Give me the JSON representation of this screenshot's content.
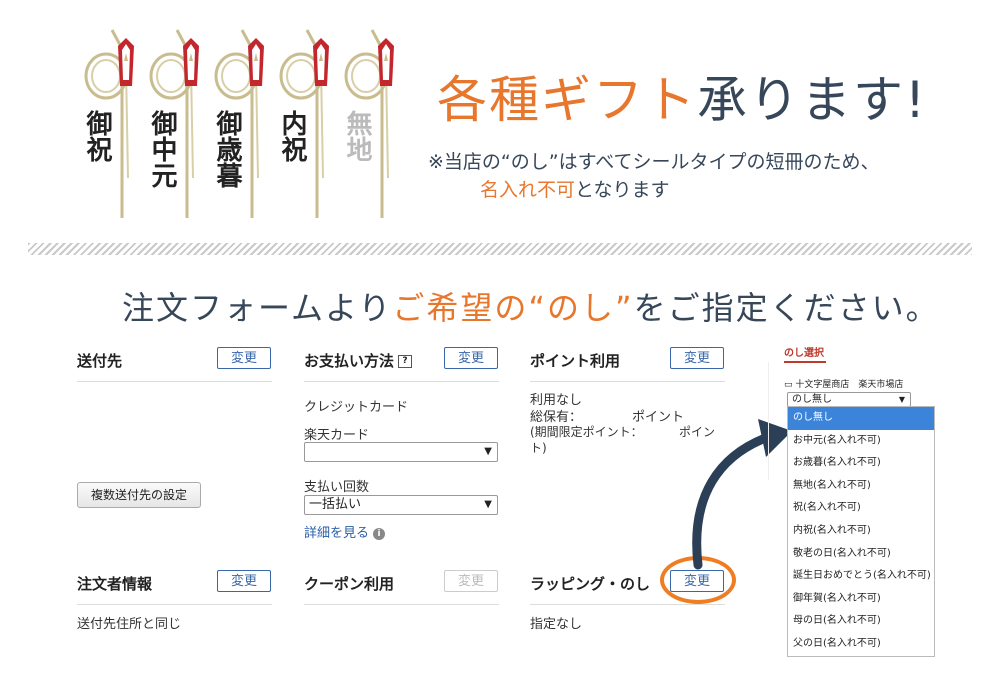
{
  "banner": {
    "noshi_labels": [
      "御祝",
      "御中元",
      "御歳暮",
      "内祝",
      "無地"
    ],
    "headline_orange": "各種ギフト",
    "headline_dark": "承ります!",
    "note_line1": "※当店の“のし”はすべてシールタイプの短冊のため、",
    "note_line2_orange": "名入れ不可",
    "note_line2_dark": "となります",
    "subheading_dark1": "注文フォームより",
    "subheading_orange": "ご希望の“のし”",
    "subheading_dark2": "をご指定ください。"
  },
  "form": {
    "shipping": {
      "title": "送付先",
      "change": "変更",
      "multi_button": "複数送付先の設定"
    },
    "payment": {
      "title": "お支払い方法",
      "change": "変更",
      "method": "クレジットカード",
      "card_label": "楽天カード",
      "card_value": "",
      "installments_label": "支払い回数",
      "installments_value": "一括払い",
      "details_link": "詳細を見る"
    },
    "points": {
      "title": "ポイント利用",
      "change": "変更",
      "line1": "利用なし",
      "line2a": "総保有：",
      "line2b": "ポイント",
      "line3a": "(期間限定ポイント：",
      "line3b": "ポイン",
      "line4": "ト)"
    },
    "orderer": {
      "title": "注文者情報",
      "change": "変更",
      "value": "送付先住所と同じ"
    },
    "coupon": {
      "title": "クーポン利用",
      "change": "変更"
    },
    "wrapping": {
      "title": "ラッピング・のし",
      "change": "変更",
      "value": "指定なし"
    }
  },
  "noshi_panel": {
    "tab": "のし選択",
    "shop_label": "十文字屋商店　楽天市場店",
    "select_value": "のし無し",
    "options": [
      "のし無し",
      "お中元(名入れ不可)",
      "お歳暮(名入れ不可)",
      "無地(名入れ不可)",
      "祝(名入れ不可)",
      "内祝(名入れ不可)",
      "敬老の日(名入れ不可)",
      "誕生日おめでとう(名入れ不可)",
      "御年賀(名入れ不可)",
      "母の日(名入れ不可)",
      "父の日(名入れ不可)"
    ],
    "selected_index": 0
  },
  "colors": {
    "accent_orange": "#e8772e",
    "text_navy": "#37475a",
    "button_blue": "#3a67a8",
    "highlight_circle": "#ef7d22",
    "selected_option": "#3b84d9"
  }
}
